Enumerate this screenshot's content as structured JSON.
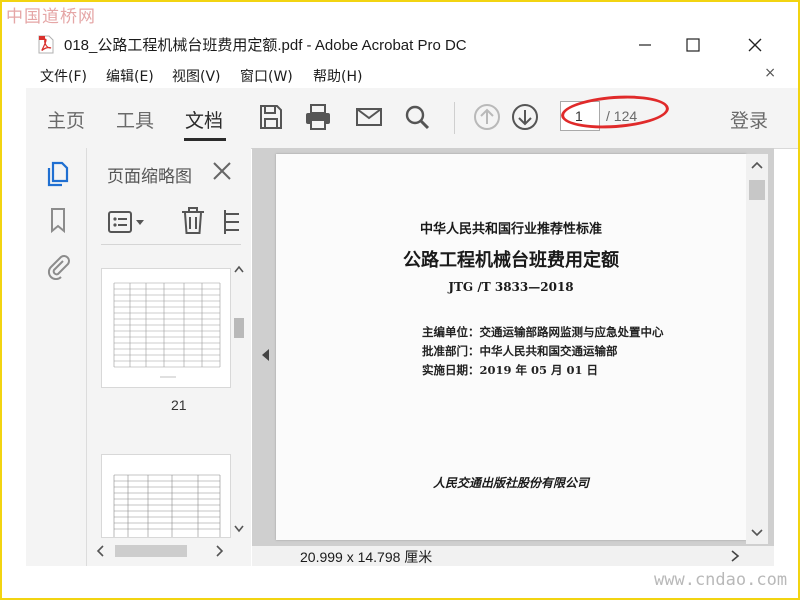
{
  "watermark_top": "中国道桥网",
  "watermark_bottom": "www.cndao.com",
  "window": {
    "title": "018_公路工程机械台班费用定额.pdf - Adobe Acrobat Pro DC",
    "icon": "pdf-file-icon"
  },
  "menu": {
    "items": [
      "文件(F)",
      "编辑(E)",
      "视图(V)",
      "窗口(W)",
      "帮助(H)"
    ],
    "close_glyph": "×"
  },
  "toolbar": {
    "tabs": [
      "主页",
      "工具",
      "文档"
    ],
    "active_tab": "文档",
    "page_current": "1",
    "page_total": "/ 124",
    "login": "登录",
    "tools": [
      "save-icon",
      "print-icon",
      "email-icon",
      "search-icon",
      "page-up-icon",
      "page-down-icon"
    ]
  },
  "pane": {
    "title": "页面缩略图",
    "thumbnail_label": "21"
  },
  "document": {
    "header": "中华人民共和国行业推荐性标准",
    "title": "公路工程机械台班费用定额",
    "code": "JTG /T  3833—2018",
    "line1": "主编单位：交通运输部路网监测与应急处置中心",
    "line2": "批准部门：中华人民共和国交通运输部",
    "line3": "实施日期：2019 年 05 月 01 日",
    "publisher": "人民交通出版社股份有限公司"
  },
  "status": {
    "page_size": "20.999 x 14.798 厘米"
  },
  "colors": {
    "highlight_ellipse": "#e02a2a",
    "frame": "#f2d411",
    "accent_blue": "#1f6fd1"
  }
}
